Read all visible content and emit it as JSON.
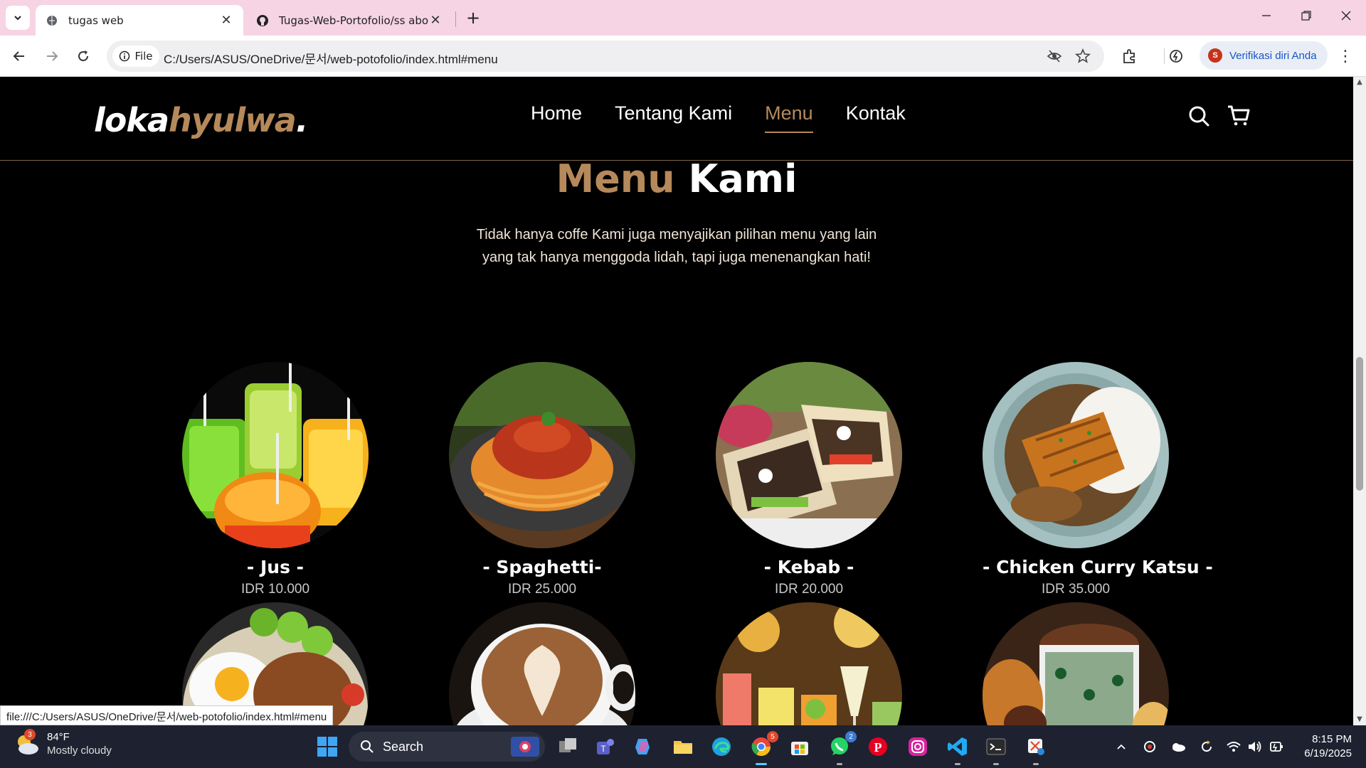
{
  "browser": {
    "tabs": [
      {
        "title": "tugas web",
        "active": true
      },
      {
        "title": "Tugas-Web-Portofolio/ss about",
        "active": false
      }
    ],
    "address": {
      "chip_label": "File",
      "url": "C:/Users/ASUS/OneDrive/문서/web-potofolio/index.html#menu"
    },
    "profile_label": "Verifikasi diri Anda",
    "profile_initial": "S",
    "status_url": "file:///C:/Users/ASUS/OneDrive/문서/web-potofolio/index.html#menu"
  },
  "site": {
    "logo": {
      "part1": "loka",
      "part2": "hyulwa",
      "dot": "."
    },
    "nav": [
      {
        "label": "Home",
        "active": false
      },
      {
        "label": "Tentang Kami",
        "active": false
      },
      {
        "label": "Menu",
        "active": true
      },
      {
        "label": "Kontak",
        "active": false
      }
    ],
    "section": {
      "title_accent": "Menu",
      "title_rest": "Kami",
      "description": "Tidak hanya coffe Kami juga menyajikan pilihan menu yang lain yang tak hanya menggoda lidah, tapi juga menenangkan hati!"
    },
    "menu_items": [
      {
        "name": "- Jus -",
        "price": "IDR 10.000",
        "image": "juice-drinks"
      },
      {
        "name": "- Spaghetti-",
        "price": "IDR 25.000",
        "image": "spaghetti-plate"
      },
      {
        "name": "- Kebab -",
        "price": "IDR 20.000",
        "image": "kebab-wrap"
      },
      {
        "name": "- Chicken Curry Katsu -",
        "price": "IDR 35.000",
        "image": "curry-katsu"
      },
      {
        "name": "",
        "price": "",
        "image": "fried-rice-egg"
      },
      {
        "name": "",
        "price": "",
        "image": "latte-art-coffee"
      },
      {
        "name": "",
        "price": "",
        "image": "cocktails"
      },
      {
        "name": "",
        "price": "",
        "image": "iced-coffee-snacks"
      }
    ],
    "colors": {
      "accent": "#b6895b",
      "background": "#000000"
    }
  },
  "taskbar": {
    "weather": {
      "temp": "84°F",
      "condition": "Mostly cloudy",
      "badge": "3"
    },
    "search_label": "Search",
    "chrome_badge": "5",
    "whatsapp_badge": "2",
    "time": "8:15 PM",
    "date": "6/19/2025"
  }
}
